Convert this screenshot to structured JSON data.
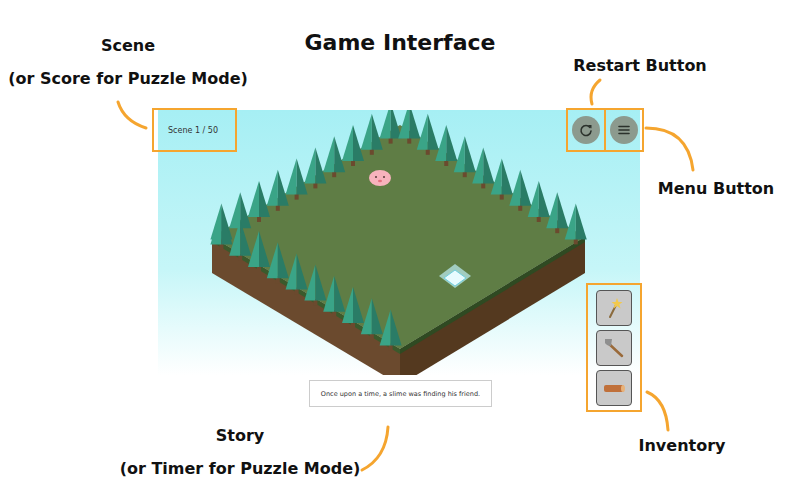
{
  "title": "Game Interface",
  "annotations": [
    {
      "lines": [
        "Scene",
        "(or Score for Puzzle Mode)"
      ]
    },
    {
      "lines": [
        "Restart Button"
      ]
    },
    {
      "lines": [
        "Menu Button"
      ]
    },
    {
      "lines": [
        "Story",
        "(or Timer for Puzzle Mode)"
      ]
    },
    {
      "lines": [
        "Inventory"
      ]
    }
  ],
  "game": {
    "scene": "Scene 1 / 50",
    "story": "Once upon a time, a slime was finding his friend.",
    "inventory": [
      {
        "kind": "wand"
      },
      {
        "kind": "axe"
      },
      {
        "kind": "log"
      }
    ]
  }
}
